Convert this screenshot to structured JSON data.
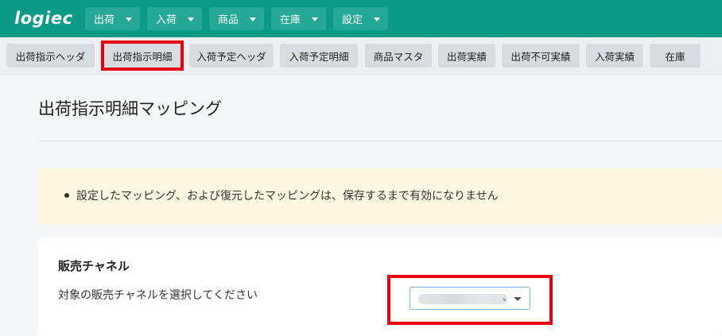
{
  "header": {
    "logo": "logiec",
    "menus": [
      {
        "label": "出荷"
      },
      {
        "label": "入荷"
      },
      {
        "label": "商品"
      },
      {
        "label": "在庫"
      },
      {
        "label": "設定"
      }
    ]
  },
  "subnav": {
    "tabs": [
      {
        "label": "出荷指示ヘッダ"
      },
      {
        "label": "出荷指示明細",
        "active": true
      },
      {
        "label": "入荷予定ヘッダ"
      },
      {
        "label": "入荷予定明細"
      },
      {
        "label": "商品マスタ"
      },
      {
        "label": "出荷実績"
      },
      {
        "label": "出荷不可実績"
      },
      {
        "label": "入荷実績"
      },
      {
        "label": "在庫"
      }
    ]
  },
  "page": {
    "title": "出荷指示明細マッピング",
    "notice": "設定したマッピング、および復元したマッピングは、保存するまで有効になりません"
  },
  "sales_channel": {
    "title": "販売チャネル",
    "label": "対象の販売チャネルを選択してください",
    "selected_suffix": "、"
  },
  "colors": {
    "brand": "#0b9a86",
    "highlight": "#e60012",
    "notice_bg": "#fef7e1"
  }
}
